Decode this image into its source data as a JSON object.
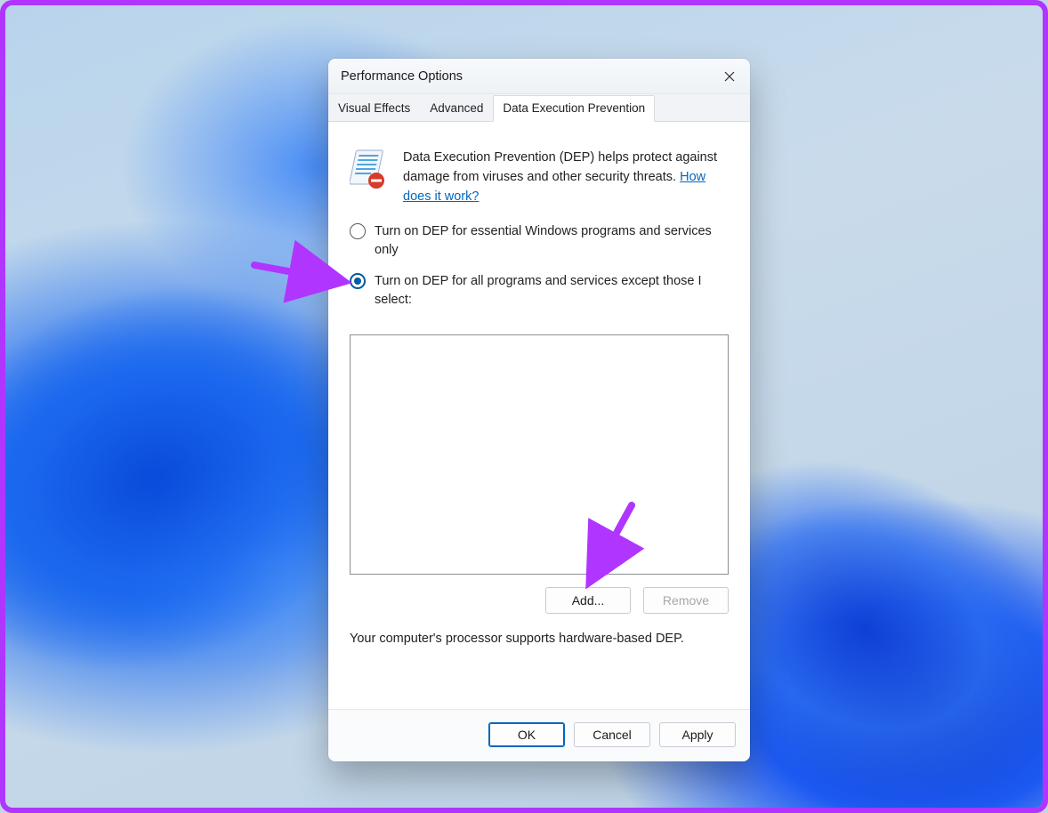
{
  "dialog": {
    "title": "Performance Options"
  },
  "tabs": [
    {
      "label": "Visual Effects",
      "active": false
    },
    {
      "label": "Advanced",
      "active": false
    },
    {
      "label": "Data Execution Prevention",
      "active": true
    }
  ],
  "intro": {
    "text": "Data Execution Prevention (DEP) helps protect against damage from viruses and other security threats. ",
    "help_link": "How does it work?"
  },
  "options": {
    "essential": "Turn on DEP for essential Windows programs and services only",
    "all_except": "Turn on DEP for all programs and services except those I select:",
    "selected": "all_except"
  },
  "buttons": {
    "add": "Add...",
    "remove": "Remove",
    "ok": "OK",
    "cancel": "Cancel",
    "apply": "Apply"
  },
  "support_text": "Your computer's processor supports hardware-based DEP.",
  "annotation": {
    "arrow_color": "#b035ff"
  }
}
